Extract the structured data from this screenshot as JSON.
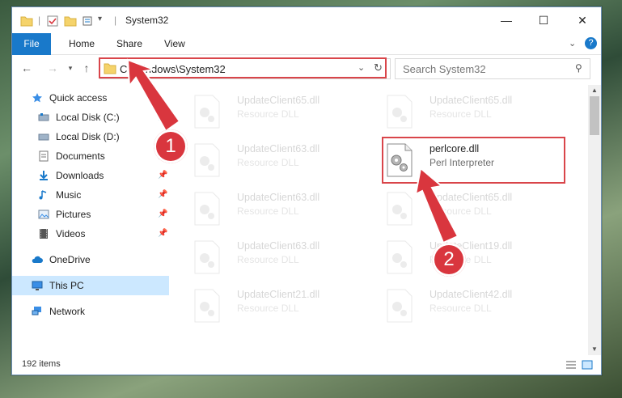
{
  "window": {
    "title": "System32"
  },
  "ribbon": {
    "tabs": [
      "File",
      "Home",
      "Share",
      "View"
    ]
  },
  "address": {
    "path": "C:\\Windows\\System32"
  },
  "search": {
    "placeholder": "Search System32"
  },
  "sidebar": {
    "items": [
      {
        "label": "Quick access",
        "icon": "star-icon"
      },
      {
        "label": "Local Disk (C:)",
        "icon": "drive-icon"
      },
      {
        "label": "Local Disk (D:)",
        "icon": "drive-icon"
      },
      {
        "label": "Documents",
        "icon": "documents-icon"
      },
      {
        "label": "Downloads",
        "icon": "downloads-icon"
      },
      {
        "label": "Music",
        "icon": "music-icon"
      },
      {
        "label": "Pictures",
        "icon": "pictures-icon"
      },
      {
        "label": "Videos",
        "icon": "videos-icon"
      },
      {
        "label": "OneDrive",
        "icon": "cloud-icon"
      },
      {
        "label": "This PC",
        "icon": "computer-icon"
      },
      {
        "label": "Network",
        "icon": "network-icon"
      }
    ]
  },
  "files": [
    {
      "name": "UpdateClient65.dll",
      "desc": "Resource DLL"
    },
    {
      "name": "UpdateClient65.dll",
      "desc": "Resource DLL"
    },
    {
      "name": "UpdateClient63.dll",
      "desc": "Resource DLL"
    },
    {
      "name": "perlcore.dll",
      "desc": "Perl Interpreter"
    },
    {
      "name": "UpdateClient63.dll",
      "desc": "Resource DLL"
    },
    {
      "name": "UpdateClient65.dll",
      "desc": "Resource DLL"
    },
    {
      "name": "UpdateClient63.dll",
      "desc": "Resource DLL"
    },
    {
      "name": "UpdateClient19.dll",
      "desc": "Resource DLL"
    },
    {
      "name": "UpdateClient21.dll",
      "desc": "Resource DLL"
    },
    {
      "name": "UpdateClient42.dll",
      "desc": "Resource DLL"
    }
  ],
  "status": {
    "item_count": "192 items"
  },
  "annotations": {
    "step1": "1",
    "step2": "2",
    "color": "#d9363e"
  }
}
